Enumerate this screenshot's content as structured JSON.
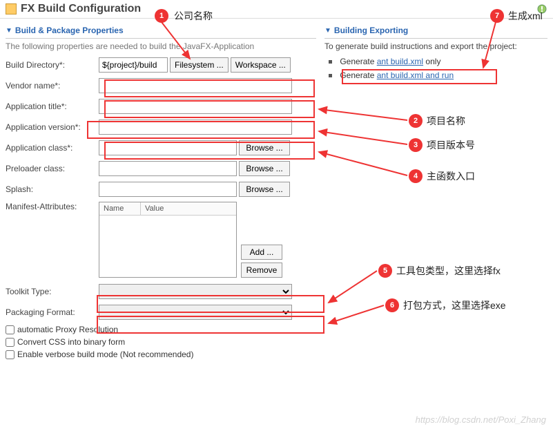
{
  "header": {
    "title": "FX Build Configuration"
  },
  "left": {
    "section_title": "Build & Package Properties",
    "desc": "The following properties are needed to build the JavaFX-Application",
    "build_dir_label": "Build Directory*:",
    "build_dir_value": "${project}/build",
    "filesystem_btn": "Filesystem ...",
    "workspace_btn": "Workspace ...",
    "vendor_label": "Vendor name*:",
    "app_title_label": "Application title*:",
    "app_version_label": "Application version*:",
    "app_class_label": "Application class*:",
    "browse_btn": "Browse ...",
    "preloader_label": "Preloader class:",
    "splash_label": "Splash:",
    "manifest_label": "Manifest-Attributes:",
    "col_name": "Name",
    "col_value": "Value",
    "add_btn": "Add ...",
    "remove_btn": "Remove",
    "toolkit_label": "Toolkit Type:",
    "packaging_label": "Packaging Format:",
    "cb1": "automatic Proxy Resolution",
    "cb2": "Convert CSS into binary form",
    "cb3": "Enable verbose build mode (Not recommended)"
  },
  "right": {
    "section_title": "Building  Exporting",
    "desc": "To generate build instructions and export the project:",
    "gen_prefix": "Generate ",
    "link1": "ant build.xml",
    "link1_suffix": " only",
    "link2": "ant build.xml and run"
  },
  "callouts": {
    "c1": "1",
    "l1": "公司名称",
    "c2": "2",
    "l2": "项目名称",
    "c3": "3",
    "l3": "项目版本号",
    "c4": "4",
    "l4": "主函数入口",
    "c5": "5",
    "l5": "工具包类型，这里选择fx",
    "c6": "6",
    "l6": "打包方式，这里选择exe",
    "c7": "7",
    "l7": "生成xml"
  },
  "watermark": "https://blog.csdn.net/Poxi_Zhang"
}
